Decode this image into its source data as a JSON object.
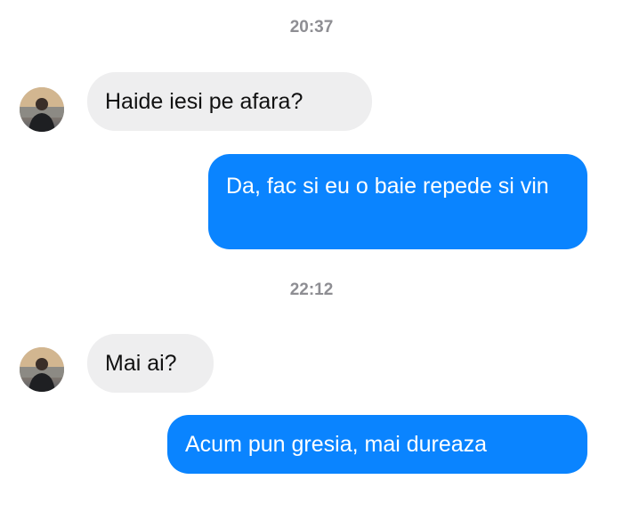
{
  "conversation": {
    "messages": [
      {
        "kind": "timestamp",
        "text": "20:37"
      },
      {
        "kind": "received",
        "text": "Haide iesi pe afara?",
        "avatar_icon": "person-photo-avatar"
      },
      {
        "kind": "sent",
        "text": "Da, fac si eu o baie repede si vin"
      },
      {
        "kind": "timestamp",
        "text": "22:12"
      },
      {
        "kind": "received",
        "text": "Mai ai?",
        "avatar_icon": "person-photo-avatar"
      },
      {
        "kind": "sent",
        "text": "Acum pun gresia, mai dureaza"
      }
    ]
  },
  "colors": {
    "sent_bubble": "#0a84ff",
    "received_bubble": "#eeeeef",
    "timestamp_text": "#8e8e93"
  }
}
